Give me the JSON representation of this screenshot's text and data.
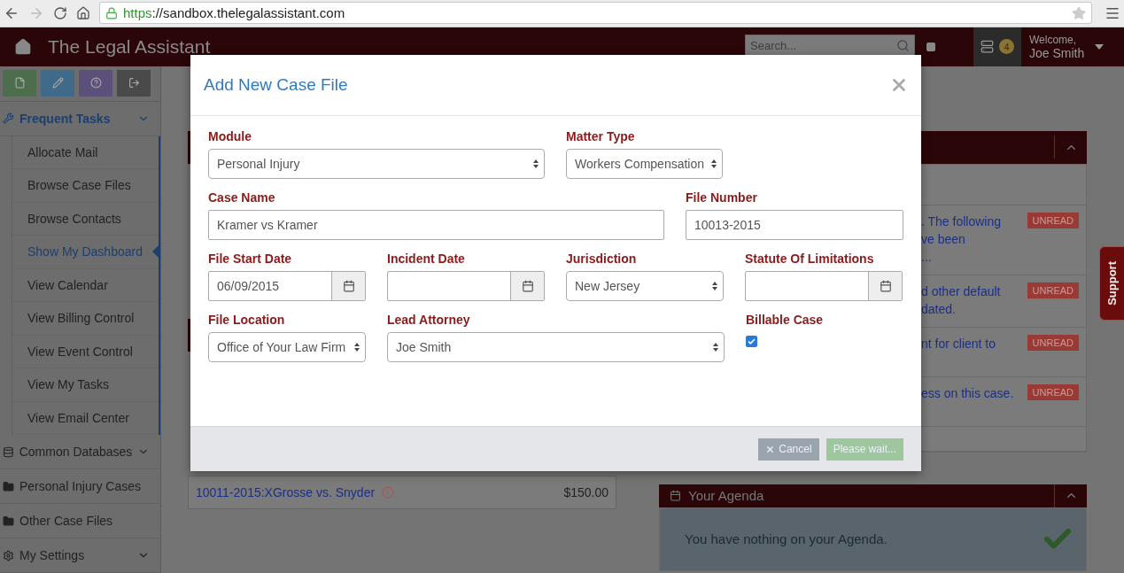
{
  "browser": {
    "scheme": "https",
    "address": "://sandbox.thelegalassistant.com"
  },
  "header": {
    "title": "The Legal Assistant",
    "search_placeholder": "Search...",
    "notification_count": "4",
    "welcome": "Welcome,",
    "user": "Joe Smith"
  },
  "sidebar": {
    "toolbar": [
      {
        "kind": "file",
        "color": "#4d6e4d"
      },
      {
        "kind": "edit",
        "color": "#3f6a8a"
      },
      {
        "kind": "help",
        "color": "#5c4f7a"
      },
      {
        "kind": "exit",
        "color": "#4a4a4a"
      }
    ],
    "sections": [
      {
        "label": "Frequent Tasks",
        "kind": "wrench",
        "expandable": true,
        "expanded": true,
        "children": [
          {
            "label": "Allocate Mail",
            "selected": false
          },
          {
            "label": "Browse Case Files",
            "selected": false
          },
          {
            "label": "Browse Contacts",
            "selected": false
          },
          {
            "label": "Show My Dashboard",
            "selected": true
          },
          {
            "label": "View Calendar",
            "selected": false
          },
          {
            "label": "View Billing Control",
            "selected": false
          },
          {
            "label": "View Event Control",
            "selected": false
          },
          {
            "label": "View My Tasks",
            "selected": false
          },
          {
            "label": "View Email Center",
            "selected": false
          }
        ]
      },
      {
        "label": "Common Databases",
        "kind": "database",
        "expandable": true,
        "expanded": false
      },
      {
        "label": "Personal Injury Cases",
        "kind": "folder",
        "expandable": false,
        "expanded": false
      },
      {
        "label": "Other Case Files",
        "kind": "folder",
        "expandable": false,
        "expanded": false
      },
      {
        "label": "My Settings",
        "kind": "gear",
        "expandable": true,
        "expanded": false
      }
    ]
  },
  "background": {
    "case_row": {
      "link": "10011-2015:XGrosse vs. Snyder",
      "amount": "$150.00"
    },
    "notifications": [
      {
        "lines": [
          ". The following",
          "ve been",
          "..."
        ],
        "badge": "UNREAD"
      },
      {
        "lines": [
          "d other default",
          "dated."
        ],
        "badge": "UNREAD"
      },
      {
        "lines": [
          "nt for client to"
        ],
        "badge": "UNREAD"
      },
      {
        "lines": [
          "ess on this case."
        ],
        "badge": "UNREAD"
      }
    ],
    "agenda": {
      "title": "Your Agenda",
      "message": "You have nothing on your Agenda."
    },
    "support_tab": "Support"
  },
  "modal": {
    "title": "Add New Case File",
    "fields": [
      {
        "kind": "select",
        "label": "Module",
        "value": "Personal Injury"
      },
      {
        "kind": "select",
        "label": "Matter Type",
        "value": "Workers Compensation"
      },
      {
        "kind": "text",
        "label": "Case Name",
        "value": "Kramer vs Kramer"
      },
      {
        "kind": "text",
        "label": "File Number",
        "value": "10013-2015"
      },
      {
        "kind": "date",
        "label": "File Start Date",
        "value": "06/09/2015"
      },
      {
        "kind": "date",
        "label": "Incident Date"
      },
      {
        "kind": "select",
        "label": "Jurisdiction",
        "value": "New Jersey"
      },
      {
        "kind": "date",
        "label": "Statute Of Limitations"
      },
      {
        "kind": "select",
        "label": "File Location",
        "value": "Office of Your Law Firm"
      },
      {
        "kind": "select",
        "label": "Lead Attorney",
        "value": "Joe Smith"
      },
      {
        "kind": "checkbox",
        "label": "Billable Case",
        "checked": true
      }
    ],
    "buttons": [
      {
        "kind": "cancel",
        "label": "Cancel"
      },
      {
        "kind": "submit",
        "label": "Please wait..."
      }
    ]
  }
}
